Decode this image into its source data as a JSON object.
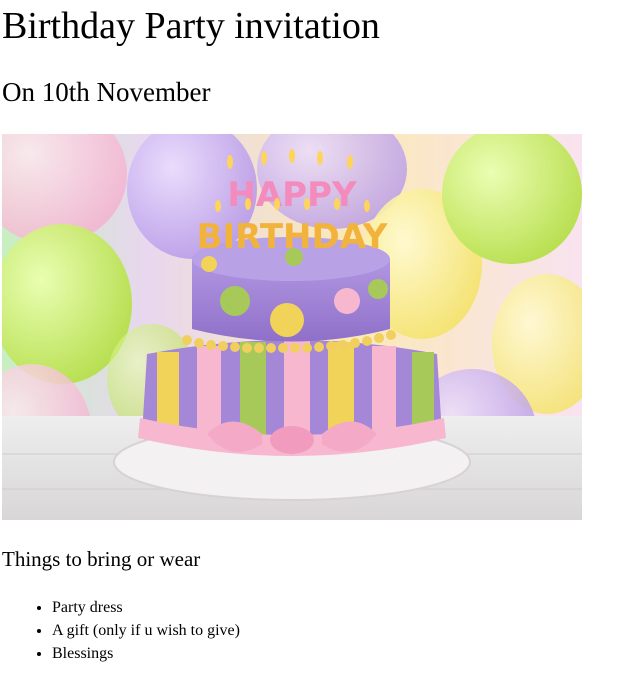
{
  "invitation": {
    "title": "Birthday Party invitation",
    "date_heading": "On 10th November",
    "photo": {
      "depicts": "cake-photo",
      "cake_topper_line1": "HAPPY",
      "cake_topper_line2": "BIRTHDAY",
      "colors": {
        "lavender": "#a487d6",
        "yellow": "#f2d35a",
        "lime": "#a7c95a",
        "pink": "#f7b8cf",
        "board": "#f4f1f2"
      }
    },
    "bring_heading": "Things to bring or wear",
    "bring_items": [
      "Party dress",
      "A gift (only if u wish to give)",
      "Blessings"
    ]
  }
}
